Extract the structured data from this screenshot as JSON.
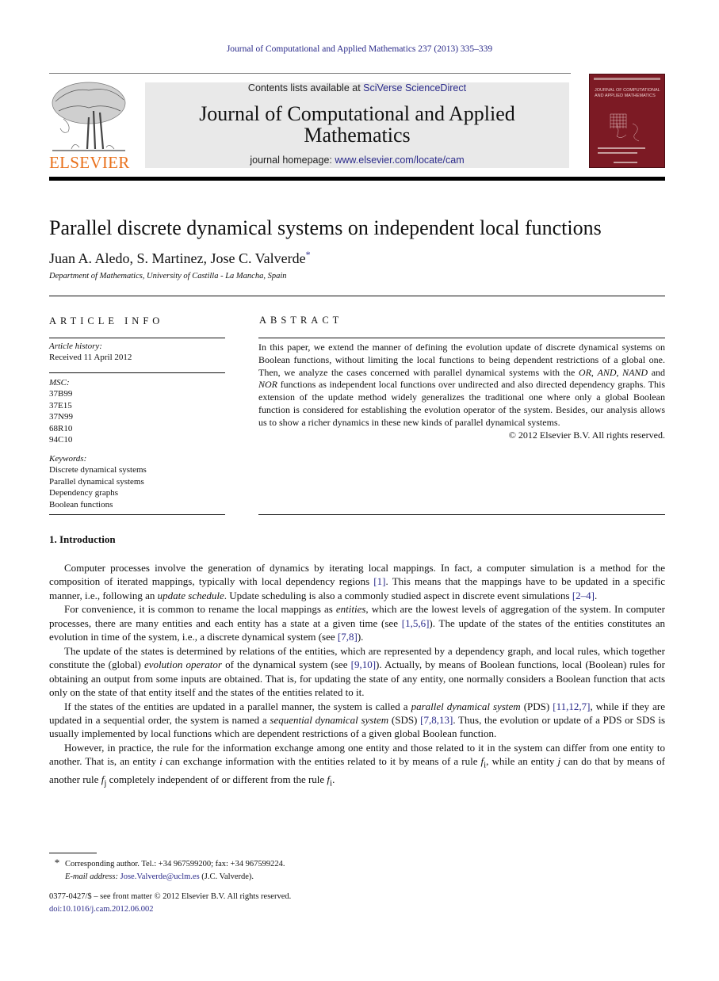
{
  "running_head": "Journal of Computational and Applied Mathematics 237 (2013) 335–339",
  "header": {
    "publisher_logo_text": "ELSEVIER",
    "contents_prefix": "Contents lists available at ",
    "contents_link": "SciVerse ScienceDirect",
    "journal_title": "Journal of Computational and Applied Mathematics",
    "homepage_prefix": "journal homepage: ",
    "homepage_link": "www.elsevier.com/locate/cam",
    "cover_title": "JOURNAL OF COMPUTATIONAL AND APPLIED MATHEMATICS",
    "colors": {
      "logo_orange": "#e9711c",
      "cover_red": "#7c1a24",
      "link_blue": "#2a2a8a",
      "banner_gray": "#e9e9e9"
    }
  },
  "article": {
    "title": "Parallel discrete dynamical systems on independent local functions",
    "authors": "Juan A. Aledo, S. Martinez, Jose C. Valverde",
    "corresponding_marker": "*",
    "affiliation": "Department of Mathematics, University of Castilla - La Mancha, Spain"
  },
  "article_info": {
    "heading": "ARTICLE INFO",
    "history_label": "Article history:",
    "history": [
      "Received 11 April 2012"
    ],
    "msc_label": "MSC:",
    "msc": [
      "37B99",
      "37E15",
      "37N99",
      "68R10",
      "94C10"
    ],
    "keywords_label": "Keywords:",
    "keywords": [
      "Discrete dynamical systems",
      "Parallel dynamical systems",
      "Dependency graphs",
      "Boolean functions"
    ]
  },
  "abstract": {
    "heading": "ABSTRACT",
    "text_1": "In this paper, we extend the manner of defining the evolution update of discrete dynamical systems on Boolean functions, without limiting the local functions to being dependent restrictions of a global one. Then, we analyze the cases concerned with parallel dynamical systems with the ",
    "em_or": "OR",
    "sep_1": ", ",
    "em_and": "AND",
    "sep_2": ", ",
    "em_nand": "NAND",
    "sep_3": " and ",
    "em_nor": "NOR",
    "text_2": " functions as independent local functions over undirected and also directed dependency graphs. This extension of the update method widely generalizes the traditional one where only a global Boolean function is considered for establishing the evolution operator of the system. Besides, our analysis allows us to show a richer dynamics in these new kinds of parallel dynamical systems.",
    "copyright": "© 2012 Elsevier B.V. All rights reserved."
  },
  "introduction": {
    "heading": "1.  Introduction",
    "p1": {
      "a": "Computer processes involve the generation of dynamics by iterating local mappings. In fact, a computer simulation is a method for the composition of iterated mappings, typically with local dependency regions ",
      "ref1": "[1]",
      "b": ". This means that the mappings have to be updated in a specific manner, i.e., following an ",
      "em": "update schedule",
      "c": ". Update scheduling is also a commonly studied aspect in discrete event simulations ",
      "ref2": "[2–4]",
      "d": "."
    },
    "p2": {
      "a": "For convenience, it is common to rename the local mappings as ",
      "em": "entities",
      "b": ", which are the lowest levels of aggregation of the system. In computer processes, there are many entities and each entity has a state at a given time (see ",
      "ref1": "[1,5,6]",
      "c": "). The update of the states of the entities constitutes an evolution in time of the system, i.e., a discrete dynamical system (see ",
      "ref2": "[7,8]",
      "d": ")."
    },
    "p3": {
      "a": "The update of the states is determined by relations of the entities, which are represented by a dependency graph, and local rules, which together constitute the (global) ",
      "em": "evolution operator",
      "b": " of the dynamical system (see ",
      "ref1": "[9,10]",
      "c": "). Actually, by means of Boolean functions, local (Boolean) rules for obtaining an output from some inputs are obtained. That is, for updating the state of any entity, one normally considers a Boolean function that acts only on the state of that entity itself and the states of the entities related to it."
    },
    "p4": {
      "a": "If the states of the entities are updated in a parallel manner, the system is called a ",
      "em1": "parallel dynamical system",
      "b": " (PDS) ",
      "ref1": "[11,12,7]",
      "c": ", while if they are updated in a sequential order, the system is named a ",
      "em2": "sequential dynamical system",
      "d": " (SDS) ",
      "ref2": "[7,8,13]",
      "e": ". Thus, the evolution or update of a PDS or SDS is usually implemented by local functions which are dependent restrictions of a given global Boolean function."
    },
    "p5": {
      "a": "However, in practice, the rule for the information exchange among one entity and those related to it in the system can differ from one entity to another. That is, an entity ",
      "em_i": "i",
      "b": " can exchange information with the entities related to it by means of a rule ",
      "f": "f",
      "sub_i": "i",
      "c": ", while an entity ",
      "em_j": "j",
      "d": " can do that by means of another rule ",
      "f2": "f",
      "sub_j": "j",
      "e": " completely independent of or different from the rule ",
      "f3": "f",
      "sub_i2": "i",
      "g": "."
    }
  },
  "footnotes": {
    "marker": "*",
    "corresponding": "Corresponding author. Tel.: +34 967599200; fax: +34 967599224.",
    "email_label": "E-mail address: ",
    "email": "Jose.Valverde@uclm.es",
    "email_suffix": " (J.C. Valverde).",
    "front_matter": "0377-0427/$ – see front matter © 2012 Elsevier B.V. All rights reserved.",
    "doi": "doi:10.1016/j.cam.2012.06.002"
  }
}
